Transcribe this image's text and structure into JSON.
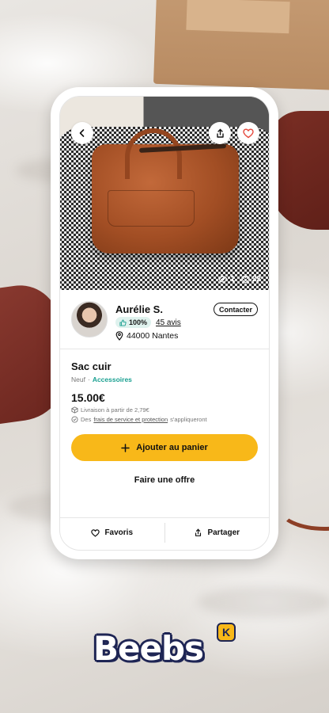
{
  "colors": {
    "accent_yellow": "#f8b819",
    "category_teal": "#1aa091",
    "rating_bg": "#dff2ee",
    "logo_navy": "#1e2554",
    "like_red": "#e5483c"
  },
  "photo": {
    "views": "1",
    "likes": "22",
    "icons": [
      "chevron-left-icon",
      "share-icon",
      "heart-icon",
      "eye-icon",
      "heart-outline-icon"
    ]
  },
  "seller": {
    "name": "Aurélie S.",
    "contact_label": "Contacter",
    "rating": "100%",
    "reviews": "45 avis",
    "location": "44000 Nantes"
  },
  "item": {
    "title": "Sac cuir",
    "condition": "Neuf",
    "separator": "·",
    "category": "Accessoires",
    "price": "15.00€",
    "shipping": "Livraison à partir de 2,79€",
    "fees_prefix": "Des",
    "fees_link": "frais de service et protection",
    "fees_suffix": "s'appliqueront"
  },
  "actions": {
    "add_to_cart": "Ajouter au panier",
    "make_offer": "Faire une offre",
    "favorites": "Favoris",
    "share": "Partager"
  },
  "brand": {
    "name": "Beebs",
    "mark": "K"
  }
}
